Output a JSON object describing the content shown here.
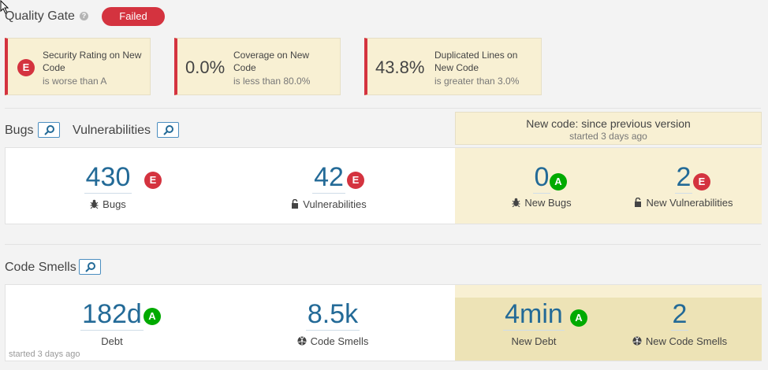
{
  "quality_gate": {
    "title": "Quality Gate",
    "status": "Failed",
    "conditions": [
      {
        "rating": "E",
        "title": "Security Rating on New Code",
        "title_line1": "Security Rating on New",
        "title_line2": "Code",
        "sub": "is worse than A"
      },
      {
        "value": "0.0%",
        "title_line1": "Coverage on New",
        "title_line2": "Code",
        "sub": "is less than 80.0%"
      },
      {
        "value": "43.8%",
        "title_line1": "Duplicated Lines on",
        "title_line2": "New Code",
        "sub": "is greater than 3.0%"
      }
    ]
  },
  "sections": {
    "bugs_title": "Bugs",
    "vulns_title": "Vulnerabilities",
    "smells_title": "Code Smells"
  },
  "new_code": {
    "title": "New code: since previous version",
    "started": "started 3 days ago"
  },
  "bugs_vulns": {
    "bugs": {
      "value": "430",
      "label": "Bugs",
      "rating": "E"
    },
    "vulns": {
      "value": "42",
      "label": "Vulnerabilities",
      "rating": "E"
    },
    "new_bugs": {
      "value": "0",
      "label": "New Bugs",
      "rating": "A"
    },
    "new_vulns": {
      "value": "2",
      "label": "New Vulnerabilities",
      "rating": "E"
    }
  },
  "code_smells": {
    "debt": {
      "value": "182d",
      "label": "Debt",
      "rating": "A"
    },
    "smells": {
      "value": "8.5k",
      "label": "Code Smells"
    },
    "new_debt": {
      "value": "4min",
      "label": "New Debt",
      "rating": "A"
    },
    "new_smells": {
      "value": "2",
      "label": "New Code Smells"
    },
    "started": "started 3 days ago"
  },
  "colors": {
    "error": "#d4333f",
    "ok": "#00aa00",
    "link": "#236a97",
    "new_code_bg": "#f8f0d3"
  }
}
